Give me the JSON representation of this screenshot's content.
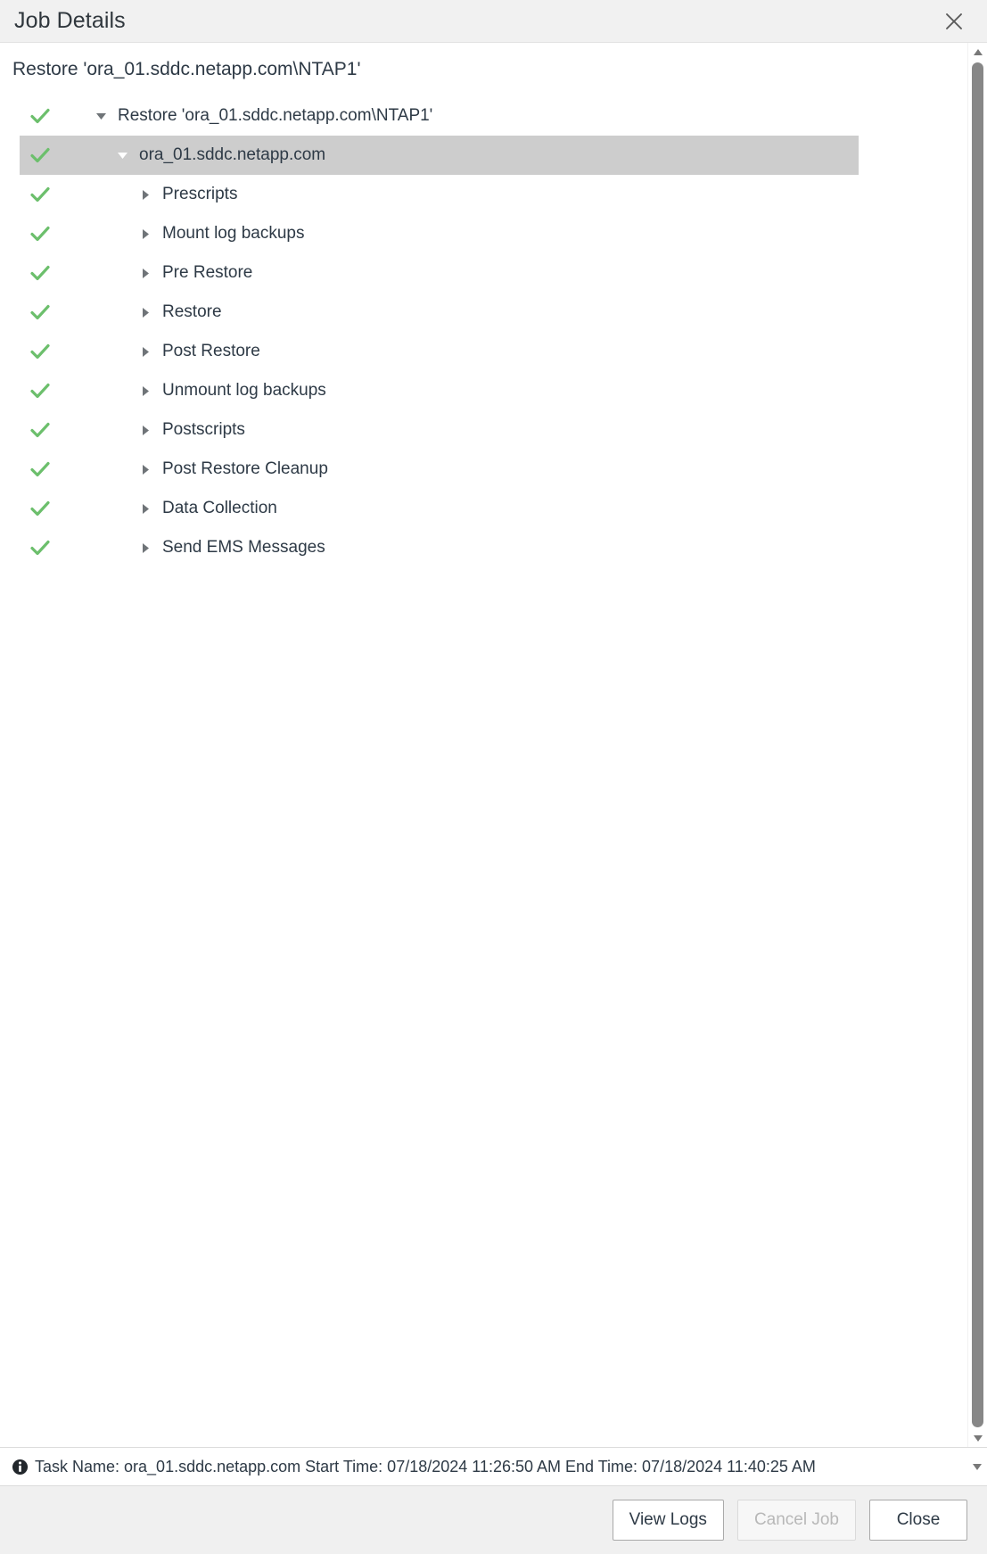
{
  "window": {
    "title": "Job Details",
    "close_icon": "close-icon"
  },
  "job": {
    "heading": "Restore 'ora_01.sddc.netapp.com\\NTAP1'"
  },
  "tree": {
    "nodes": [
      {
        "label": "Restore 'ora_01.sddc.netapp.com\\NTAP1'",
        "status": "success",
        "expanded": true,
        "level": 0,
        "selected": false
      },
      {
        "label": "ora_01.sddc.netapp.com",
        "status": "success",
        "expanded": true,
        "level": 1,
        "selected": true
      },
      {
        "label": "Prescripts",
        "status": "success",
        "expanded": false,
        "level": 2,
        "selected": false
      },
      {
        "label": "Mount log backups",
        "status": "success",
        "expanded": false,
        "level": 2,
        "selected": false
      },
      {
        "label": "Pre Restore",
        "status": "success",
        "expanded": false,
        "level": 2,
        "selected": false
      },
      {
        "label": "Restore",
        "status": "success",
        "expanded": false,
        "level": 2,
        "selected": false
      },
      {
        "label": "Post Restore",
        "status": "success",
        "expanded": false,
        "level": 2,
        "selected": false
      },
      {
        "label": "Unmount log backups",
        "status": "success",
        "expanded": false,
        "level": 2,
        "selected": false
      },
      {
        "label": "Postscripts",
        "status": "success",
        "expanded": false,
        "level": 2,
        "selected": false
      },
      {
        "label": "Post Restore Cleanup",
        "status": "success",
        "expanded": false,
        "level": 2,
        "selected": false
      },
      {
        "label": "Data Collection",
        "status": "success",
        "expanded": false,
        "level": 2,
        "selected": false
      },
      {
        "label": "Send EMS Messages",
        "status": "success",
        "expanded": false,
        "level": 2,
        "selected": false
      }
    ]
  },
  "statusbar": {
    "icon": "info-icon",
    "text": "Task Name: ora_01.sddc.netapp.com Start Time: 07/18/2024 11:26:50 AM End Time: 07/18/2024 11:40:25 AM"
  },
  "footer": {
    "buttons": [
      {
        "label": "View Logs",
        "name": "view-logs-button",
        "disabled": false
      },
      {
        "label": "Cancel Job",
        "name": "cancel-job-button",
        "disabled": true
      },
      {
        "label": "Close",
        "name": "close-button",
        "disabled": false
      }
    ]
  },
  "colors": {
    "success_check": "#6cbf6c",
    "header_bg": "#f1f1f1",
    "selected_row_bg": "#cdcdcd",
    "footer_bg": "#f0f0f0",
    "scrollbar_thumb": "#878787",
    "text": "#2e3a46"
  }
}
